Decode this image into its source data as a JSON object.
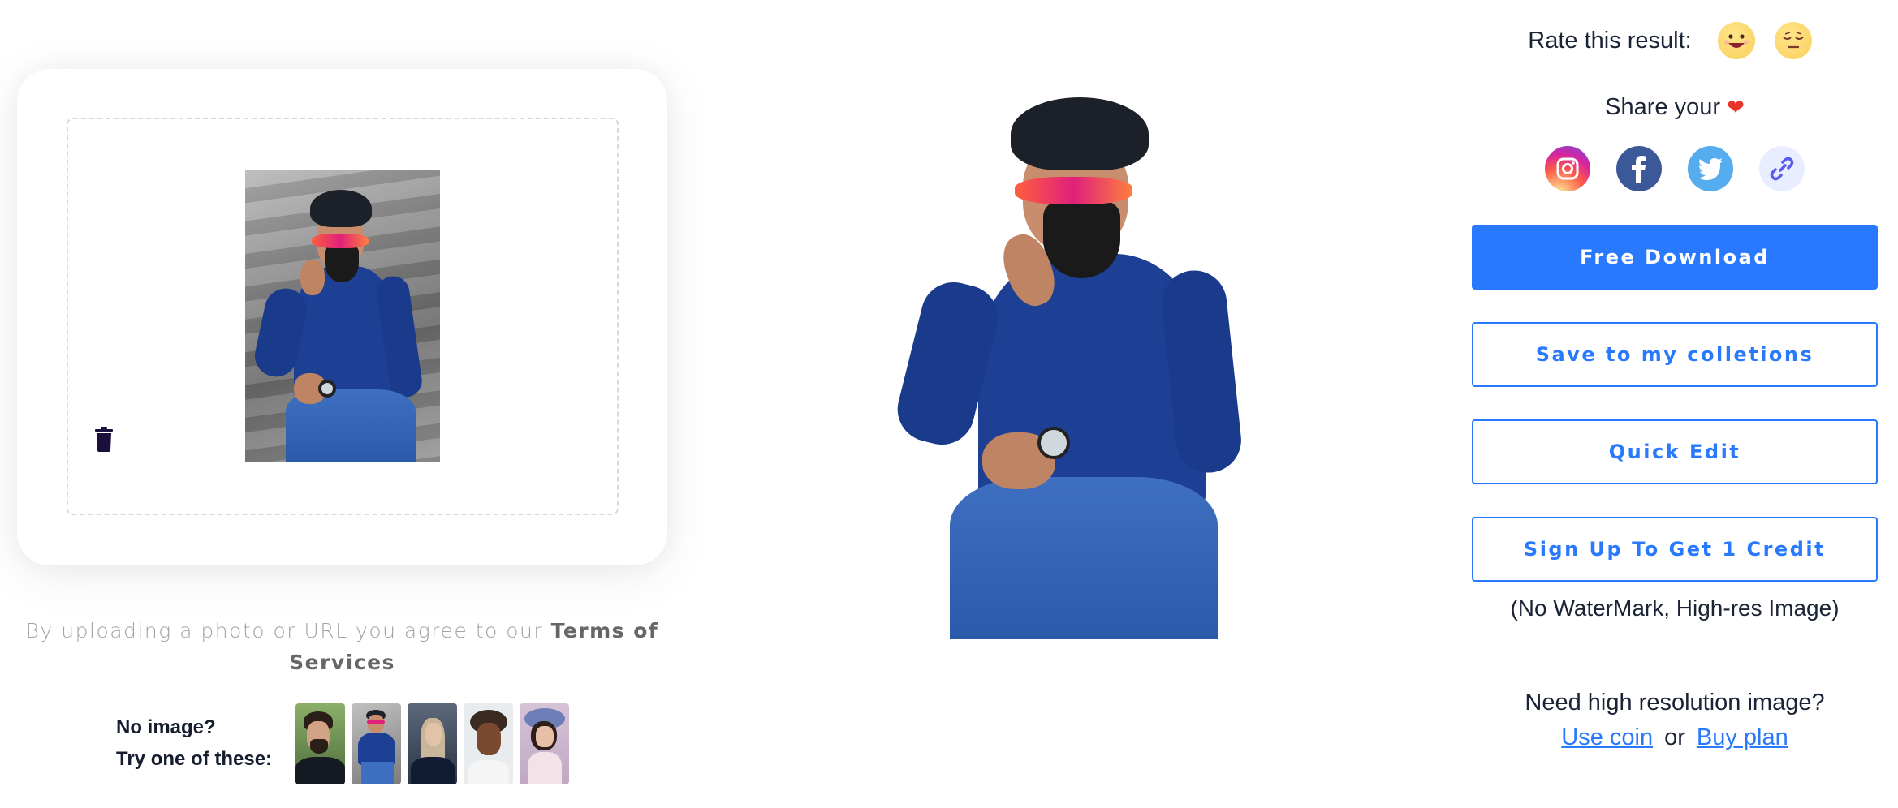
{
  "upload": {
    "terms_prefix": "By uploading a photo or URL you agree to our ",
    "terms_link": "Terms of Services",
    "samples_line1": "No image?",
    "samples_line2": "Try one of these:",
    "sample_thumbnails": [
      {
        "name": "man-with-beard-portrait"
      },
      {
        "name": "man-pointing-on-stairs"
      },
      {
        "name": "woman-with-braids"
      },
      {
        "name": "man-with-dreadlocks"
      },
      {
        "name": "girl-with-flower-crown"
      }
    ],
    "delete_icon": "trash-icon"
  },
  "rating": {
    "label": "Rate this result:",
    "options": [
      {
        "name": "happy-emoji",
        "glyph": "😀"
      },
      {
        "name": "sad-emoji",
        "glyph": "😔"
      }
    ]
  },
  "share": {
    "label": "Share your",
    "heart": "❤",
    "networks": [
      {
        "name": "instagram",
        "color": "#d6249f"
      },
      {
        "name": "facebook",
        "color": "#3b5998",
        "glyph": "f"
      },
      {
        "name": "twitter",
        "color": "#55acee"
      },
      {
        "name": "copy-link",
        "color": "#e8eeff",
        "icon_color": "#5b5bf0"
      }
    ]
  },
  "actions": {
    "free_download": "Free Download",
    "save_collection": "Save to my colletions",
    "quick_edit": "Quick Edit",
    "sign_up": "Sign Up To Get 1 Credit",
    "note": "(No WaterMark, High-res Image)"
  },
  "hires": {
    "question": "Need high resolution image?",
    "use_coin": "Use coin",
    "or": "or",
    "buy_plan": "Buy plan"
  },
  "colors": {
    "accent": "#2979ff",
    "text": "#1b2436",
    "muted": "#a3a3a3"
  }
}
